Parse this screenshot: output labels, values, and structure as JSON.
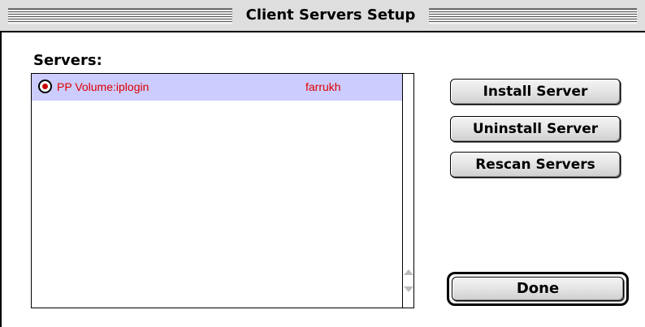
{
  "window": {
    "title": "Client Servers Setup"
  },
  "servers": {
    "label": "Servers:",
    "rows": [
      {
        "name": "PP Volume:iplogin",
        "user": "farrukh",
        "selected": true
      }
    ]
  },
  "buttons": {
    "install": "Install Server",
    "uninstall": "Uninstall Server",
    "rescan": "Rescan Servers",
    "done": "Done"
  },
  "colors": {
    "selection_bg": "#ccccff",
    "row_text": "#dd0000",
    "window_bg": "#ffffff"
  },
  "icons": {
    "row_icon": "radio-selected-icon",
    "scroll_up": "scroll-up-arrow-icon",
    "scroll_down": "scroll-down-arrow-icon"
  }
}
